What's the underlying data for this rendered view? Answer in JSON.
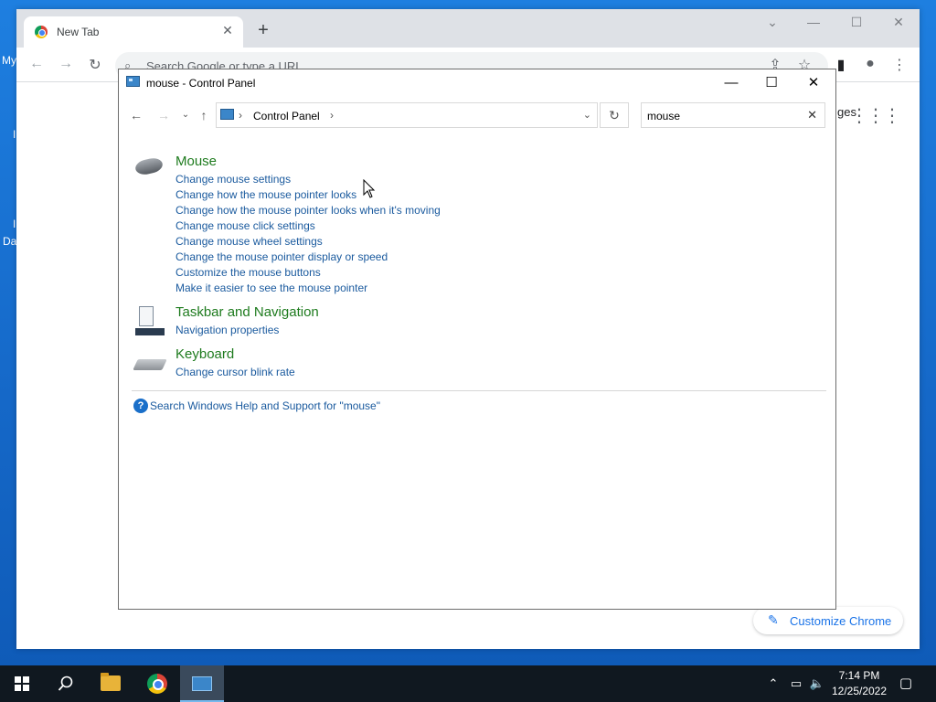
{
  "desktop": {
    "fragments": [
      "My",
      "I",
      "I",
      "Da"
    ]
  },
  "chrome": {
    "tab_title": "New Tab",
    "omnibox_placeholder": "Search Google or type a URL",
    "ntp_fragment": "ges",
    "customize_label": "Customize Chrome"
  },
  "control_panel": {
    "window_title": "mouse - Control Panel",
    "breadcrumb": "Control Panel",
    "search_value": "mouse",
    "groups": [
      {
        "title": "Mouse",
        "icon": "mouse-icon",
        "links": [
          "Change mouse settings",
          "Change how the mouse pointer looks",
          "Change how the mouse pointer looks when it's moving",
          "Change mouse click settings",
          "Change mouse wheel settings",
          "Change the mouse pointer display or speed",
          "Customize the mouse buttons",
          "Make it easier to see the mouse pointer"
        ]
      },
      {
        "title": "Taskbar and Navigation",
        "icon": "taskbar-icon",
        "links": [
          "Navigation properties"
        ]
      },
      {
        "title": "Keyboard",
        "icon": "keyboard-icon",
        "links": [
          "Change cursor blink rate"
        ]
      }
    ],
    "help_text": "Search Windows Help and Support for \"mouse\""
  },
  "taskbar": {
    "time": "7:14 PM",
    "date": "12/25/2022"
  },
  "colors": {
    "link": "#1a5a9e",
    "group_title": "#1e7b1e",
    "taskbar": "#101820",
    "desktop": "#1b74d3"
  }
}
